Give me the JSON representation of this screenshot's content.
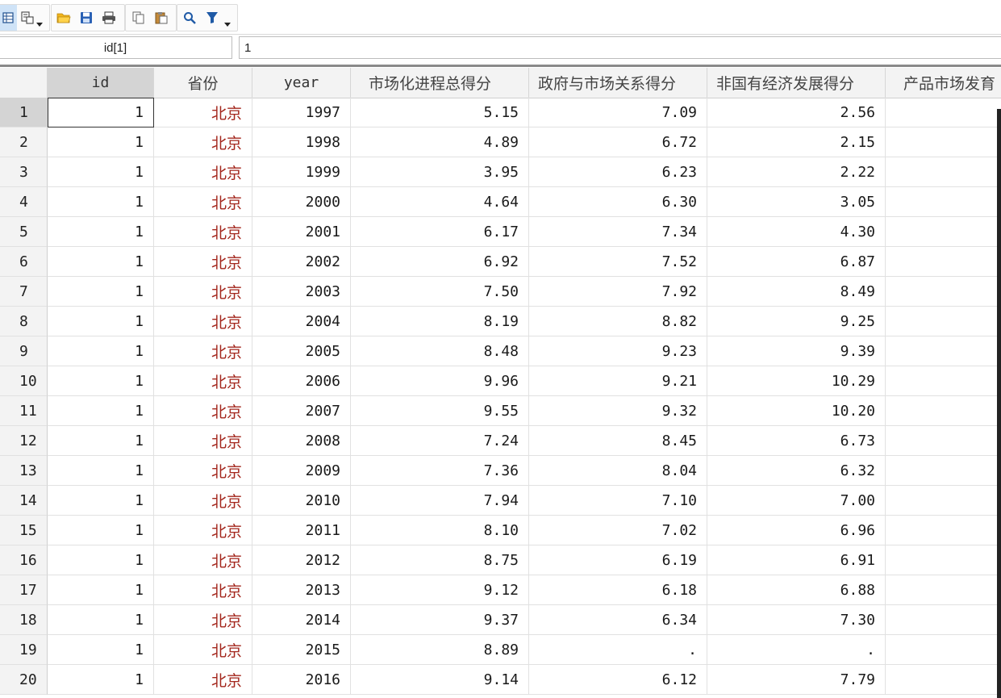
{
  "toolbar": {
    "buttons": [
      {
        "name": "data-editor-icon"
      },
      {
        "name": "variables-manager-icon"
      },
      {
        "name": "open-folder-icon"
      },
      {
        "name": "save-icon"
      },
      {
        "name": "print-icon"
      },
      {
        "name": "copy-icon"
      },
      {
        "name": "paste-icon"
      },
      {
        "name": "find-icon"
      },
      {
        "name": "filter-icon"
      }
    ]
  },
  "namebar": {
    "varname": "id[1]",
    "value": "1"
  },
  "grid": {
    "columns": [
      "id",
      "省份",
      "year",
      "市场化进程总得分",
      "政府与市场关系得分",
      "非国有经济发展得分",
      "产品市场发育"
    ],
    "rows": [
      {
        "n": "1",
        "id": "1",
        "prov": "北京",
        "year": "1997",
        "c1": "5.15",
        "c2": "7.09",
        "c3": "2.56"
      },
      {
        "n": "2",
        "id": "1",
        "prov": "北京",
        "year": "1998",
        "c1": "4.89",
        "c2": "6.72",
        "c3": "2.15"
      },
      {
        "n": "3",
        "id": "1",
        "prov": "北京",
        "year": "1999",
        "c1": "3.95",
        "c2": "6.23",
        "c3": "2.22"
      },
      {
        "n": "4",
        "id": "1",
        "prov": "北京",
        "year": "2000",
        "c1": "4.64",
        "c2": "6.30",
        "c3": "3.05"
      },
      {
        "n": "5",
        "id": "1",
        "prov": "北京",
        "year": "2001",
        "c1": "6.17",
        "c2": "7.34",
        "c3": "4.30"
      },
      {
        "n": "6",
        "id": "1",
        "prov": "北京",
        "year": "2002",
        "c1": "6.92",
        "c2": "7.52",
        "c3": "6.87"
      },
      {
        "n": "7",
        "id": "1",
        "prov": "北京",
        "year": "2003",
        "c1": "7.50",
        "c2": "7.92",
        "c3": "8.49"
      },
      {
        "n": "8",
        "id": "1",
        "prov": "北京",
        "year": "2004",
        "c1": "8.19",
        "c2": "8.82",
        "c3": "9.25"
      },
      {
        "n": "9",
        "id": "1",
        "prov": "北京",
        "year": "2005",
        "c1": "8.48",
        "c2": "9.23",
        "c3": "9.39"
      },
      {
        "n": "10",
        "id": "1",
        "prov": "北京",
        "year": "2006",
        "c1": "9.96",
        "c2": "9.21",
        "c3": "10.29"
      },
      {
        "n": "11",
        "id": "1",
        "prov": "北京",
        "year": "2007",
        "c1": "9.55",
        "c2": "9.32",
        "c3": "10.20"
      },
      {
        "n": "12",
        "id": "1",
        "prov": "北京",
        "year": "2008",
        "c1": "7.24",
        "c2": "8.45",
        "c3": "6.73"
      },
      {
        "n": "13",
        "id": "1",
        "prov": "北京",
        "year": "2009",
        "c1": "7.36",
        "c2": "8.04",
        "c3": "6.32"
      },
      {
        "n": "14",
        "id": "1",
        "prov": "北京",
        "year": "2010",
        "c1": "7.94",
        "c2": "7.10",
        "c3": "7.00"
      },
      {
        "n": "15",
        "id": "1",
        "prov": "北京",
        "year": "2011",
        "c1": "8.10",
        "c2": "7.02",
        "c3": "6.96"
      },
      {
        "n": "16",
        "id": "1",
        "prov": "北京",
        "year": "2012",
        "c1": "8.75",
        "c2": "6.19",
        "c3": "6.91"
      },
      {
        "n": "17",
        "id": "1",
        "prov": "北京",
        "year": "2013",
        "c1": "9.12",
        "c2": "6.18",
        "c3": "6.88"
      },
      {
        "n": "18",
        "id": "1",
        "prov": "北京",
        "year": "2014",
        "c1": "9.37",
        "c2": "6.34",
        "c3": "7.30"
      },
      {
        "n": "19",
        "id": "1",
        "prov": "北京",
        "year": "2015",
        "c1": "8.89",
        "c2": ".",
        "c3": "."
      },
      {
        "n": "20",
        "id": "1",
        "prov": "北京",
        "year": "2016",
        "c1": "9.14",
        "c2": "6.12",
        "c3": "7.79"
      }
    ]
  }
}
